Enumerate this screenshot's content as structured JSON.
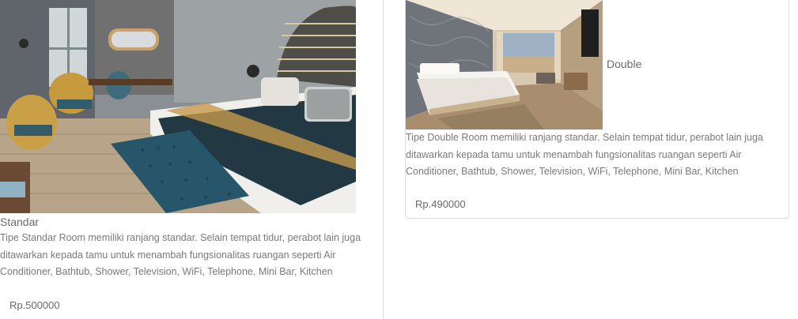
{
  "rooms": [
    {
      "name": "Standar",
      "description": "Tipe Standar Room memiliki ranjang standar. Selain tempat tidur, perabot lain juga ditawarkan kepada tamu untuk menambah fungsionalitas ruangan seperti Air Conditioner, Bathtub, Shower, Television, WiFi, Telephone, Mini Bar, Kitchen",
      "price": "Rp.500000"
    },
    {
      "name": "Double",
      "description": "Tipe Double Room memiliki ranjang standar. Selain tempat tidur, perabot lain juga ditawarkan kepada tamu untuk menambah fungsionalitas ruangan seperti Air Conditioner, Bathtub, Shower, Television, WiFi, Telephone, Mini Bar, Kitchen",
      "price": "Rp.490000"
    }
  ]
}
